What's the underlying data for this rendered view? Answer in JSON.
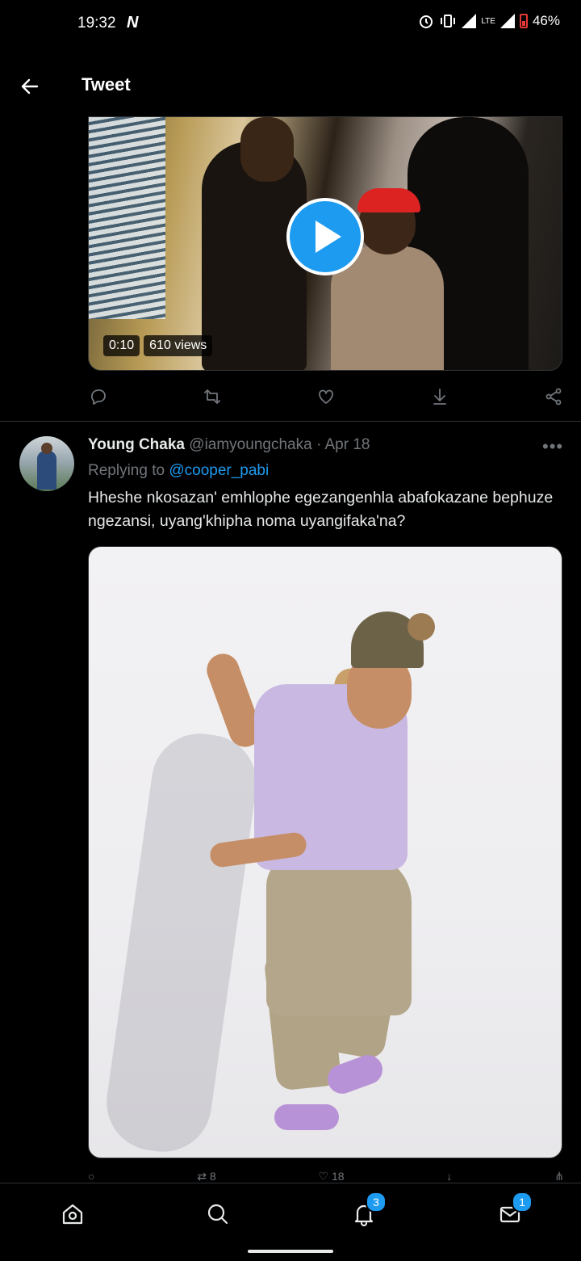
{
  "status_bar": {
    "time": "19:32",
    "carrier_logo": "N",
    "network": "LTE",
    "battery": "46%",
    "icons": [
      "alarm-icon",
      "vibrate-icon",
      "signal-icon",
      "battery-low-icon"
    ]
  },
  "header": {
    "back_icon": "arrow-left-icon",
    "title": "Tweet"
  },
  "video": {
    "duration": "0:10",
    "views": "610 views",
    "play_icon": "play-icon"
  },
  "video_actions": [
    "reply-icon",
    "retweet-icon",
    "like-icon",
    "download-icon",
    "share-icon"
  ],
  "tweet": {
    "name": "Young Chaka",
    "handle": "@iamyoungchaka",
    "separator": "·",
    "date": "Apr 18",
    "more_icon": "more-icon",
    "replying_prefix": "Replying to",
    "replying_to": "@cooper_pabi",
    "text": "Hheshe nkosazan' emhlophe egezangenhla abafokazane bephuze ngezansi, uyang'khipha noma uyangifaka'na?",
    "retweets": "8",
    "likes": "18"
  },
  "bottom_nav": {
    "items": [
      {
        "icon": "home-icon"
      },
      {
        "icon": "search-icon"
      },
      {
        "icon": "notifications-icon",
        "badge": "3"
      },
      {
        "icon": "messages-icon",
        "badge": "1"
      }
    ]
  },
  "colors": {
    "background": "#000000",
    "accent": "#1d9bf0",
    "text_primary": "#e7e9ea",
    "text_secondary": "#71767b"
  }
}
